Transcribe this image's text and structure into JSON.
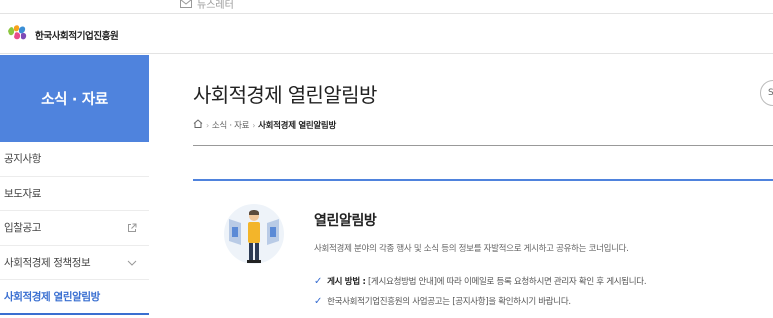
{
  "util": {
    "newsletter": "뉴스레터"
  },
  "header": {
    "logo_text": "한국사회적기업진흥원"
  },
  "sidebar": {
    "title": "소식 · 자료",
    "items": [
      {
        "label": "공지사항"
      },
      {
        "label": "보도자료"
      },
      {
        "label": "입찰공고",
        "icon": "external-link-icon"
      },
      {
        "label": "사회적경제 정책정보",
        "icon": "chevron-down-icon"
      },
      {
        "label": "사회적경제 열린알림방",
        "active": true
      }
    ]
  },
  "page": {
    "title": "사회적경제 열린알림방",
    "side_button_glyph": "S",
    "breadcrumb": {
      "home_icon": "home-icon",
      "section": "소식 · 자료",
      "current": "사회적경제 열린알림방"
    }
  },
  "card": {
    "heading": "열린알림방",
    "description": "사회적경제 분야의 각종 행사 및 소식 등의 정보를 자발적으로 게시하고 공유하는 코너입니다.",
    "bullet1_label": "게시 방법 :",
    "bullet1_text": "[게시요청방법 안내]에 따라 이메일로 등록 요청하시면 관리자 확인 후 게시됩니다.",
    "bullet2_text": "한국사회적기업진흥원의 사업공고는 [공지사항]을 확인하시기 바랍니다."
  },
  "colors": {
    "accent": "#4f83dd",
    "link": "#3a6fd1"
  }
}
